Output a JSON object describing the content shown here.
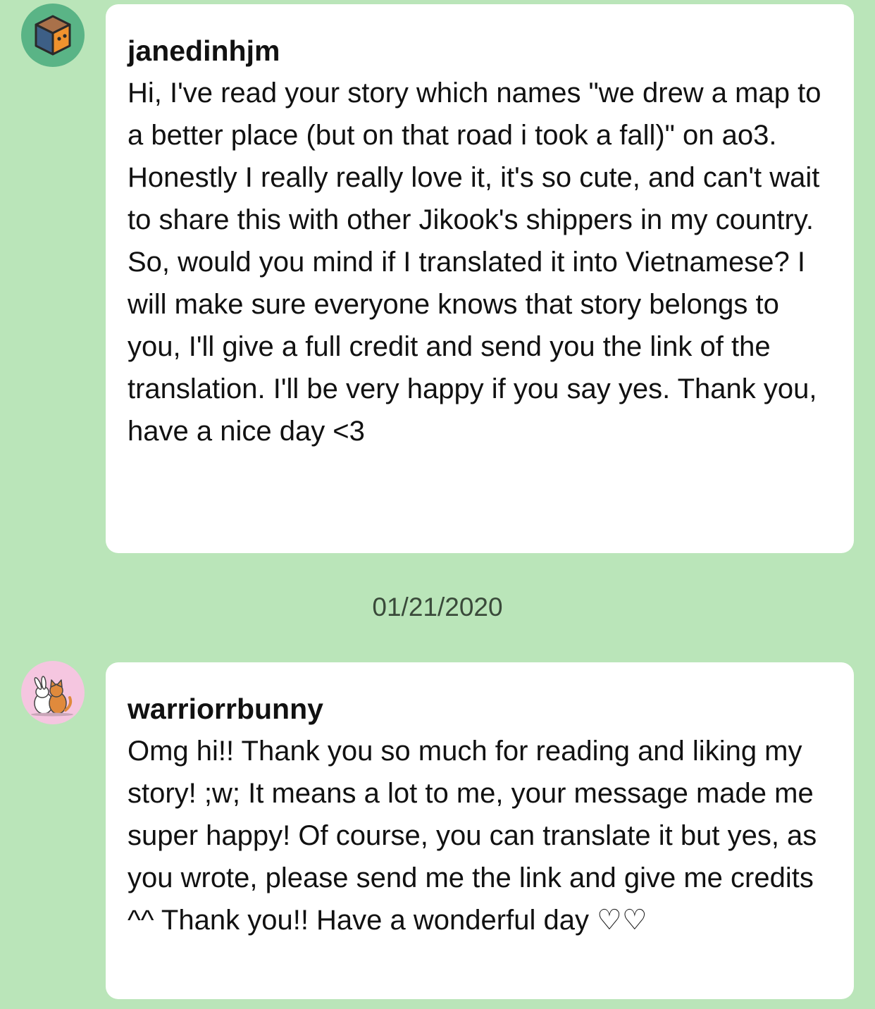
{
  "conversation": {
    "messages": [
      {
        "username": "janedinhjm",
        "avatar_icon": "cube-icon",
        "text": "Hi, I've read your story which names \"we drew a map to a better place (but on that road i took a fall)\" on ao3. Honestly I really really love it, it's so cute, and can't wait to share this with other Jikook's shippers in my country. So, would you mind if I translated it into Vietnamese? I will make sure everyone knows that story belongs to you, I'll give a full credit and send you the link of the translation. I'll be very happy if you say yes. Thank you, have a nice day <3"
      },
      {
        "username": "warriorrbunny",
        "avatar_icon": "bunny-cat-icon",
        "text": "Omg hi!! Thank you so much for reading and liking my story! ;w; It means a lot to me, your message made me super happy! Of course, you can translate it but yes, as you wrote, please send me the link and give me credits ^^ Thank you!! Have a wonderful day ♡♡"
      }
    ],
    "date_divider": "01/21/2020"
  },
  "colors": {
    "background": "#bae5b9",
    "bubble": "#ffffff",
    "text": "#111111",
    "date_text": "#3a4a3a",
    "avatar_1_bg": "#5ab486",
    "avatar_2_bg": "#f5c6e0"
  }
}
